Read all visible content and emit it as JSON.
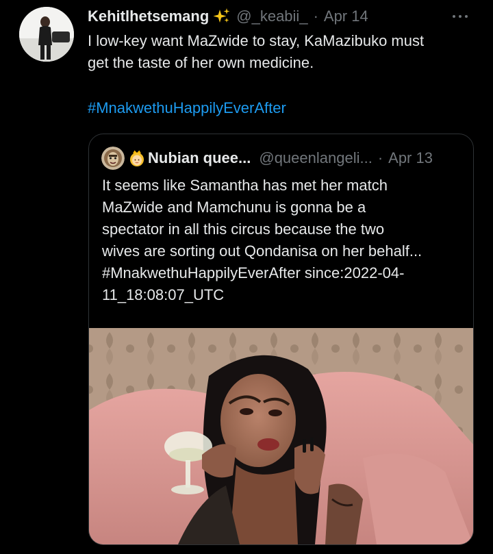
{
  "tweet": {
    "display_name": "Kehitlhetsemang",
    "name_emoji": "sparkles-icon",
    "handle": "@_keabii_",
    "separator": "·",
    "date": "Apr 14",
    "text_line1": "I low-key want MaZwide to stay, KaMazibuko must",
    "text_line2": "get the taste of her own medicine.",
    "hashtag": "#MnakwethuHappilyEverAfter",
    "more_icon": "more-horizontal-icon"
  },
  "quoted_tweet": {
    "display_name": "Nubian quee...",
    "name_emoji": "princess-emoji-icon",
    "handle": "@queenlangeli...",
    "separator": "·",
    "date": "Apr 13",
    "text": "It seems like Samantha has met her match\nMaZwide and Mamchunu is gonna be a\nspectator in all this circus because the two\nwives are sorting out Qondanisa on her behalf...\n#MnakwethuHappilyEverAfter since:2022-04-\n11_18:08:07_UTC",
    "media": "photo"
  },
  "colors": {
    "background": "#000000",
    "text": "#e7e9ea",
    "muted": "#71767b",
    "link": "#1d9bf0",
    "border": "#2f3336"
  }
}
